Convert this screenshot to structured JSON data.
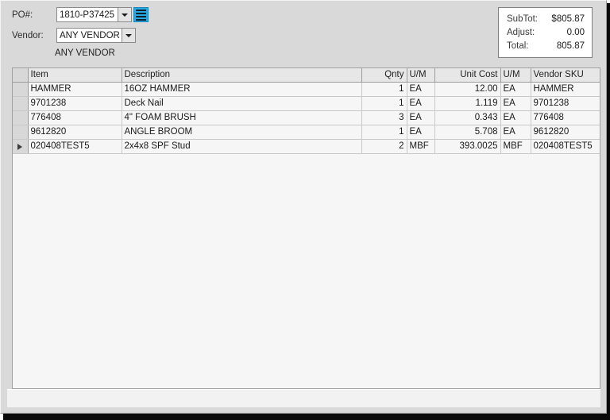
{
  "form": {
    "po_label": "PO#:",
    "po_value": "1810-P37425",
    "vendor_label": "Vendor:",
    "vendor_value": "ANY VENDOR",
    "vendor_caption": "ANY VENDOR",
    "list_button_icon": "list-lines-icon",
    "dropdown_icon": "chevron-down-icon",
    "accent_color": "#2aa8e0"
  },
  "totals": {
    "subtotal_label": "SubTot:",
    "subtotal_value": "$805.87",
    "adjust_label": "Adjust:",
    "adjust_value": "0.00",
    "total_label": "Total:",
    "total_value": "805.87"
  },
  "grid": {
    "columns": [
      {
        "key": "item",
        "label": "Item",
        "align": "left"
      },
      {
        "key": "desc",
        "label": "Description",
        "align": "left"
      },
      {
        "key": "qnty",
        "label": "Qnty",
        "align": "right"
      },
      {
        "key": "um1",
        "label": "U/M",
        "align": "left"
      },
      {
        "key": "cost",
        "label": "Unit Cost",
        "align": "right"
      },
      {
        "key": "um2",
        "label": "U/M",
        "align": "left"
      },
      {
        "key": "sku",
        "label": "Vendor SKU",
        "align": "left"
      }
    ],
    "rows": [
      {
        "item": "HAMMER",
        "desc": "16OZ HAMMER",
        "qnty": "1",
        "um1": "EA",
        "cost": "12.00",
        "um2": "EA",
        "sku": "HAMMER",
        "current": false
      },
      {
        "item": "9701238",
        "desc": "Deck Nail",
        "qnty": "1",
        "um1": "EA",
        "cost": "1.119",
        "um2": "EA",
        "sku": "9701238",
        "current": false
      },
      {
        "item": "776408",
        "desc": "4\" FOAM BRUSH",
        "qnty": "3",
        "um1": "EA",
        "cost": "0.343",
        "um2": "EA",
        "sku": "776408",
        "current": false
      },
      {
        "item": "9612820",
        "desc": "ANGLE BROOM",
        "qnty": "1",
        "um1": "EA",
        "cost": "5.708",
        "um2": "EA",
        "sku": "9612820",
        "current": false
      },
      {
        "item": "020408TEST5",
        "desc": "2x4x8 SPF Stud",
        "qnty": "2",
        "um1": "MBF",
        "cost": "393.0025",
        "um2": "MBF",
        "sku": "020408TEST5",
        "current": true
      }
    ]
  }
}
